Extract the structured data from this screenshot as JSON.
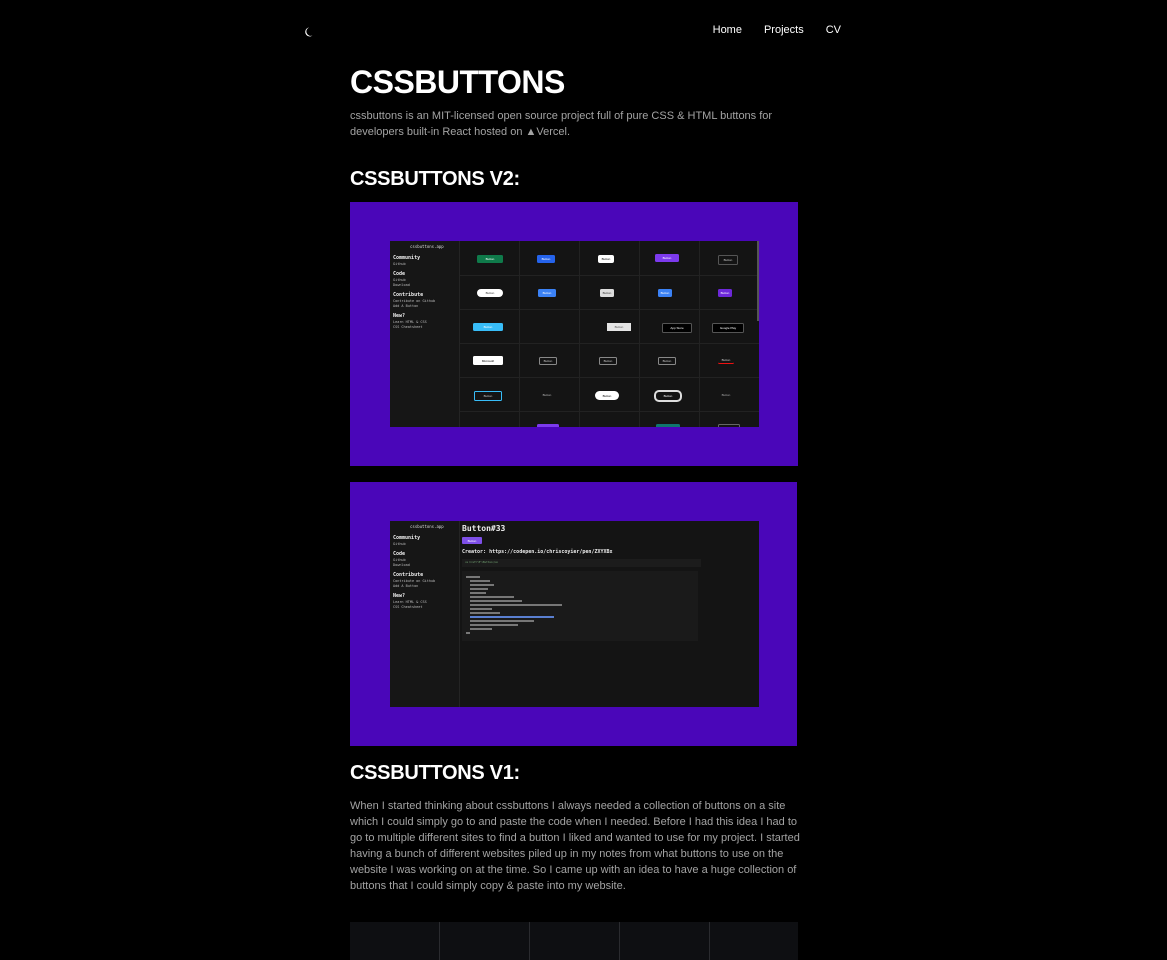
{
  "nav": {
    "theme_icon": "moon-icon",
    "links": [
      "Home",
      "Projects",
      "CV"
    ]
  },
  "page": {
    "title": "CSSBUTTONS",
    "description_before": "cssbuttons is an MIT-licensed open source project full of pure CSS & HTML buttons for developers built-in React hosted on ",
    "vercel_glyph": "▲",
    "vercel_label": "Vercel.",
    "v2_heading": "CSSBUTTONS V2:",
    "v1_heading": "CSSBUTTONS V1:",
    "v1_paragraph": "When I started thinking about cssbuttons I always needed a collection of buttons on a site which I could simply go to and paste the code when I needed. Before I had this idea I had to go to multiple different sites to find a button I liked and wanted to use for my project. I started having a bunch of different websites piled up in my notes from what buttons to use on the website I was working on at the time. So I came up with an idea to have a huge collection of buttons that I could simply copy & paste into my website."
  },
  "screenshot_app": {
    "site_name": "cssbuttons.app",
    "sidebar": [
      {
        "heading": "Community",
        "items": [
          "Github"
        ]
      },
      {
        "heading": "Code",
        "items": [
          "Github",
          "Download"
        ]
      },
      {
        "heading": "Contribute",
        "items": [
          "Contribute on Github",
          "Add A Button"
        ]
      },
      {
        "heading": "New?",
        "items": [
          "Learn HTML & CSS",
          "CSS Cheatsheet"
        ]
      }
    ],
    "button_label": "Button",
    "app_store_label": "App Store",
    "google_play_label": "Google Play",
    "microsoft_label": "Microsoft",
    "detail_title": "Button#33",
    "detail_creator": "Creator: https://codepen.io/chriscoyier/pen/ZXYXBx",
    "detail_code_bar": "<a href=\"#\">Button</a>"
  },
  "colors": {
    "background": "#000000",
    "accent_purple": "#4a06b9",
    "muted_text": "#a3a3a3"
  }
}
